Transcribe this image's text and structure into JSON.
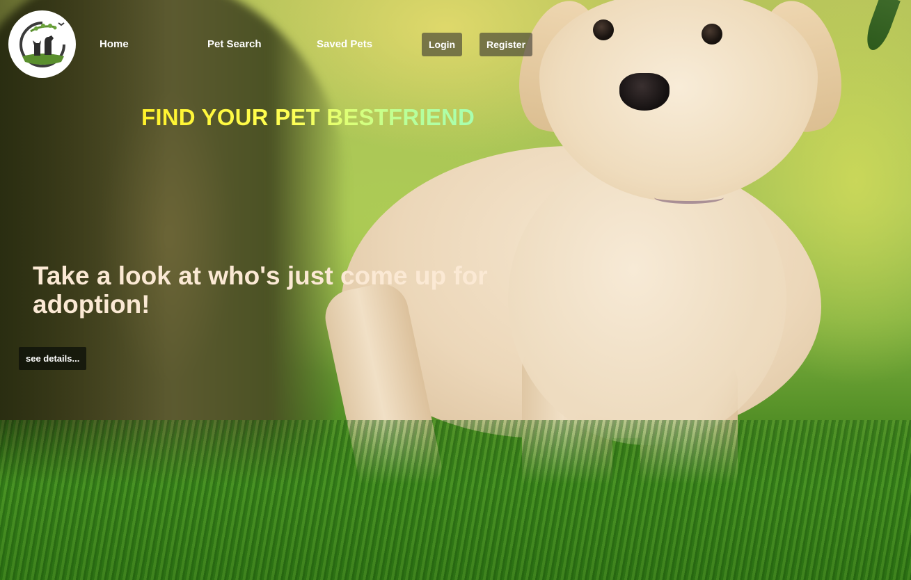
{
  "nav": {
    "home_label": "Home",
    "pet_search_label": "Pet Search",
    "saved_pets_label": "Saved Pets",
    "login_label": "Login",
    "register_label": "Register",
    "logo_icon": "pet-logo-icon"
  },
  "hero": {
    "title": "FIND YOUR PET BESTFRIEND",
    "subtitle": "Take a look at who's just come up for adoption!",
    "details_button_label": "see details..."
  },
  "colors": {
    "title_gradient_start": "#fff22a",
    "title_gradient_end": "#a7ffb0",
    "subtitle_text": "#fbe9d4",
    "nav_button_bg": "#3c3a32",
    "details_button_bg": "#0f120a",
    "logo_green": "#5a8f2e"
  }
}
